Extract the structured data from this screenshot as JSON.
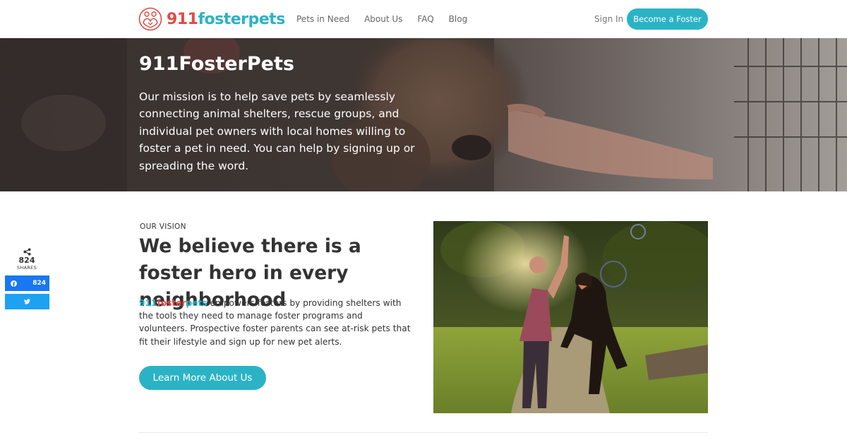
{
  "header": {
    "logo": {
      "part1": "911",
      "part2": "foster",
      "part3": "pets",
      "icon": "pets-heart-logo-icon"
    },
    "nav": [
      "Pets in Need",
      "About Us",
      "FAQ",
      "Blog"
    ],
    "sign_in": "Sign In",
    "cta": "Become a Foster"
  },
  "hero": {
    "title": "911FosterPets",
    "text": "Our mission is to help save pets by seamlessly connecting animal shelters, rescue groups, and individual pet owners with local homes willing to foster a pet in need. You can help by signing up or spreading the word."
  },
  "share": {
    "count": "824",
    "label": "SHARES",
    "facebook_count": "824",
    "icons": {
      "share": "share-icon",
      "facebook": "facebook-icon",
      "twitter": "twitter-icon"
    }
  },
  "vision": {
    "eyebrow": "OUR VISION",
    "headline": "We believe there is a foster hero in every neighborhood",
    "brand": {
      "part1": "911",
      "part2": "foster",
      "part3": "pets"
    },
    "body": " empowers fosters by providing shelters with the tools they need to manage foster programs and volunteers. Prospective foster parents can see at-risk pets that fit their lifestyle and sign up for new pet alerts.",
    "button": "Learn More About Us"
  },
  "colors": {
    "accent": "#2bb3c5",
    "brand_red": "#e04b46",
    "facebook": "#1877f2",
    "twitter": "#1da1f2"
  }
}
